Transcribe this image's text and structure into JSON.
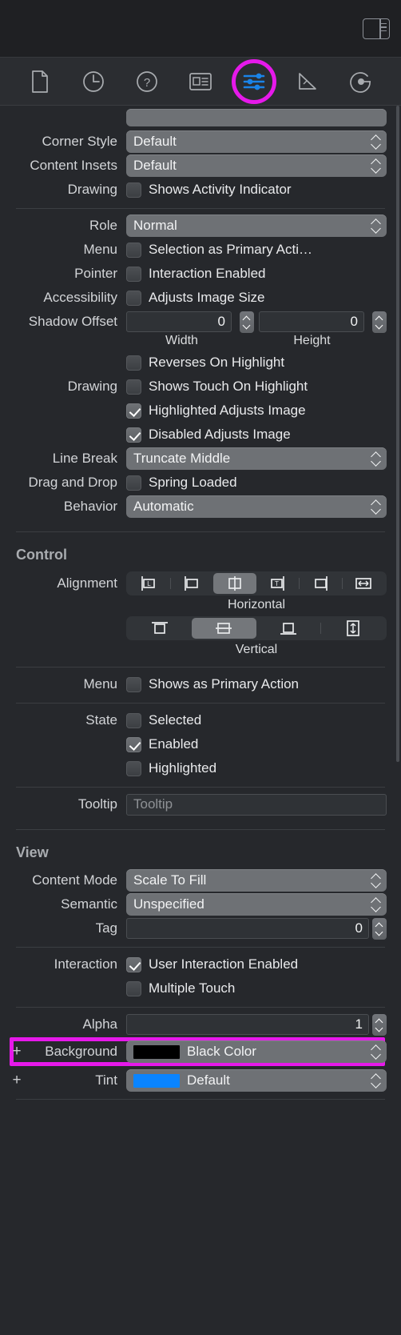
{
  "topbar": {
    "panel_toggle_name": "inspector-panel-toggle"
  },
  "tabs": [
    {
      "name": "file-inspector",
      "icon": "document-icon",
      "selected": false
    },
    {
      "name": "history-inspector",
      "icon": "clock-icon",
      "selected": false
    },
    {
      "name": "quick-help-inspector",
      "icon": "question-mark-icon",
      "selected": false
    },
    {
      "name": "identity-inspector",
      "icon": "id-card-icon",
      "selected": false
    },
    {
      "name": "attributes-inspector",
      "icon": "sliders-icon",
      "selected": true
    },
    {
      "name": "size-inspector",
      "icon": "ruler-icon",
      "selected": false
    },
    {
      "name": "connections-inspector",
      "icon": "arrow-circle-icon",
      "selected": false
    }
  ],
  "colors": {
    "highlight": "#e619ea",
    "accent_blue": "#1a84e8",
    "swatch_black": "#000000",
    "swatch_tint": "#0a84ff"
  },
  "button_section": {
    "corner_style": {
      "label": "Corner Style",
      "value": "Default"
    },
    "content_insets": {
      "label": "Content Insets",
      "value": "Default"
    },
    "drawing": {
      "label": "Drawing",
      "checkbox": "Shows Activity Indicator",
      "checked": false
    },
    "role": {
      "label": "Role",
      "value": "Normal"
    },
    "menu": {
      "label": "Menu",
      "checkbox": "Selection as Primary Acti…",
      "checked": false
    },
    "pointer": {
      "label": "Pointer",
      "checkbox": "Interaction Enabled",
      "checked": false
    },
    "accessibility": {
      "label": "Accessibility",
      "checkbox": "Adjusts Image Size",
      "checked": false
    },
    "shadow_offset": {
      "label": "Shadow Offset",
      "width_value": "0",
      "width_caption": "Width",
      "height_value": "0",
      "height_caption": "Height"
    },
    "drawing2": {
      "label": "Drawing",
      "items": [
        {
          "text": "Reverses On Highlight",
          "checked": false
        },
        {
          "text": "Shows Touch On Highlight",
          "checked": false
        },
        {
          "text": "Highlighted Adjusts Image",
          "checked": true
        },
        {
          "text": "Disabled Adjusts Image",
          "checked": true
        }
      ]
    },
    "line_break": {
      "label": "Line Break",
      "value": "Truncate Middle"
    },
    "drag_and_drop": {
      "label": "Drag and Drop",
      "checkbox": "Spring Loaded",
      "checked": false
    },
    "behavior": {
      "label": "Behavior",
      "value": "Automatic"
    }
  },
  "control_section": {
    "title": "Control",
    "alignment": {
      "label": "Alignment",
      "horizontal_caption": "Horizontal",
      "horizontal_options": [
        {
          "name": "align-leading",
          "selected": false
        },
        {
          "name": "align-left",
          "selected": false
        },
        {
          "name": "align-center",
          "selected": true
        },
        {
          "name": "align-trailing",
          "selected": false
        },
        {
          "name": "align-right",
          "selected": false
        },
        {
          "name": "align-fill-horizontal",
          "selected": false
        }
      ],
      "vertical_caption": "Vertical",
      "vertical_options": [
        {
          "name": "align-top",
          "selected": false
        },
        {
          "name": "align-middle",
          "selected": true
        },
        {
          "name": "align-bottom",
          "selected": false
        },
        {
          "name": "align-fill-vertical",
          "selected": false
        }
      ]
    },
    "menu": {
      "label": "Menu",
      "checkbox": "Shows as Primary Action",
      "checked": false
    },
    "state": {
      "label": "State",
      "items": [
        {
          "text": "Selected",
          "checked": false
        },
        {
          "text": "Enabled",
          "checked": true
        },
        {
          "text": "Highlighted",
          "checked": false
        }
      ]
    },
    "tooltip": {
      "label": "Tooltip",
      "value": "",
      "placeholder": "Tooltip"
    }
  },
  "view_section": {
    "title": "View",
    "content_mode": {
      "label": "Content Mode",
      "value": "Scale To Fill"
    },
    "semantic": {
      "label": "Semantic",
      "value": "Unspecified"
    },
    "tag": {
      "label": "Tag",
      "value": "0"
    },
    "interaction": {
      "label": "Interaction",
      "items": [
        {
          "text": "User Interaction Enabled",
          "checked": true
        },
        {
          "text": "Multiple Touch",
          "checked": false
        }
      ]
    },
    "alpha": {
      "label": "Alpha",
      "value": "1"
    },
    "background": {
      "label": "Background",
      "value": "Black Color",
      "swatch": "#000000",
      "highlighted": true,
      "add_label": "+"
    },
    "tint": {
      "label": "Tint",
      "value": "Default",
      "swatch": "#0a84ff",
      "highlighted": false,
      "add_label": "+"
    }
  }
}
